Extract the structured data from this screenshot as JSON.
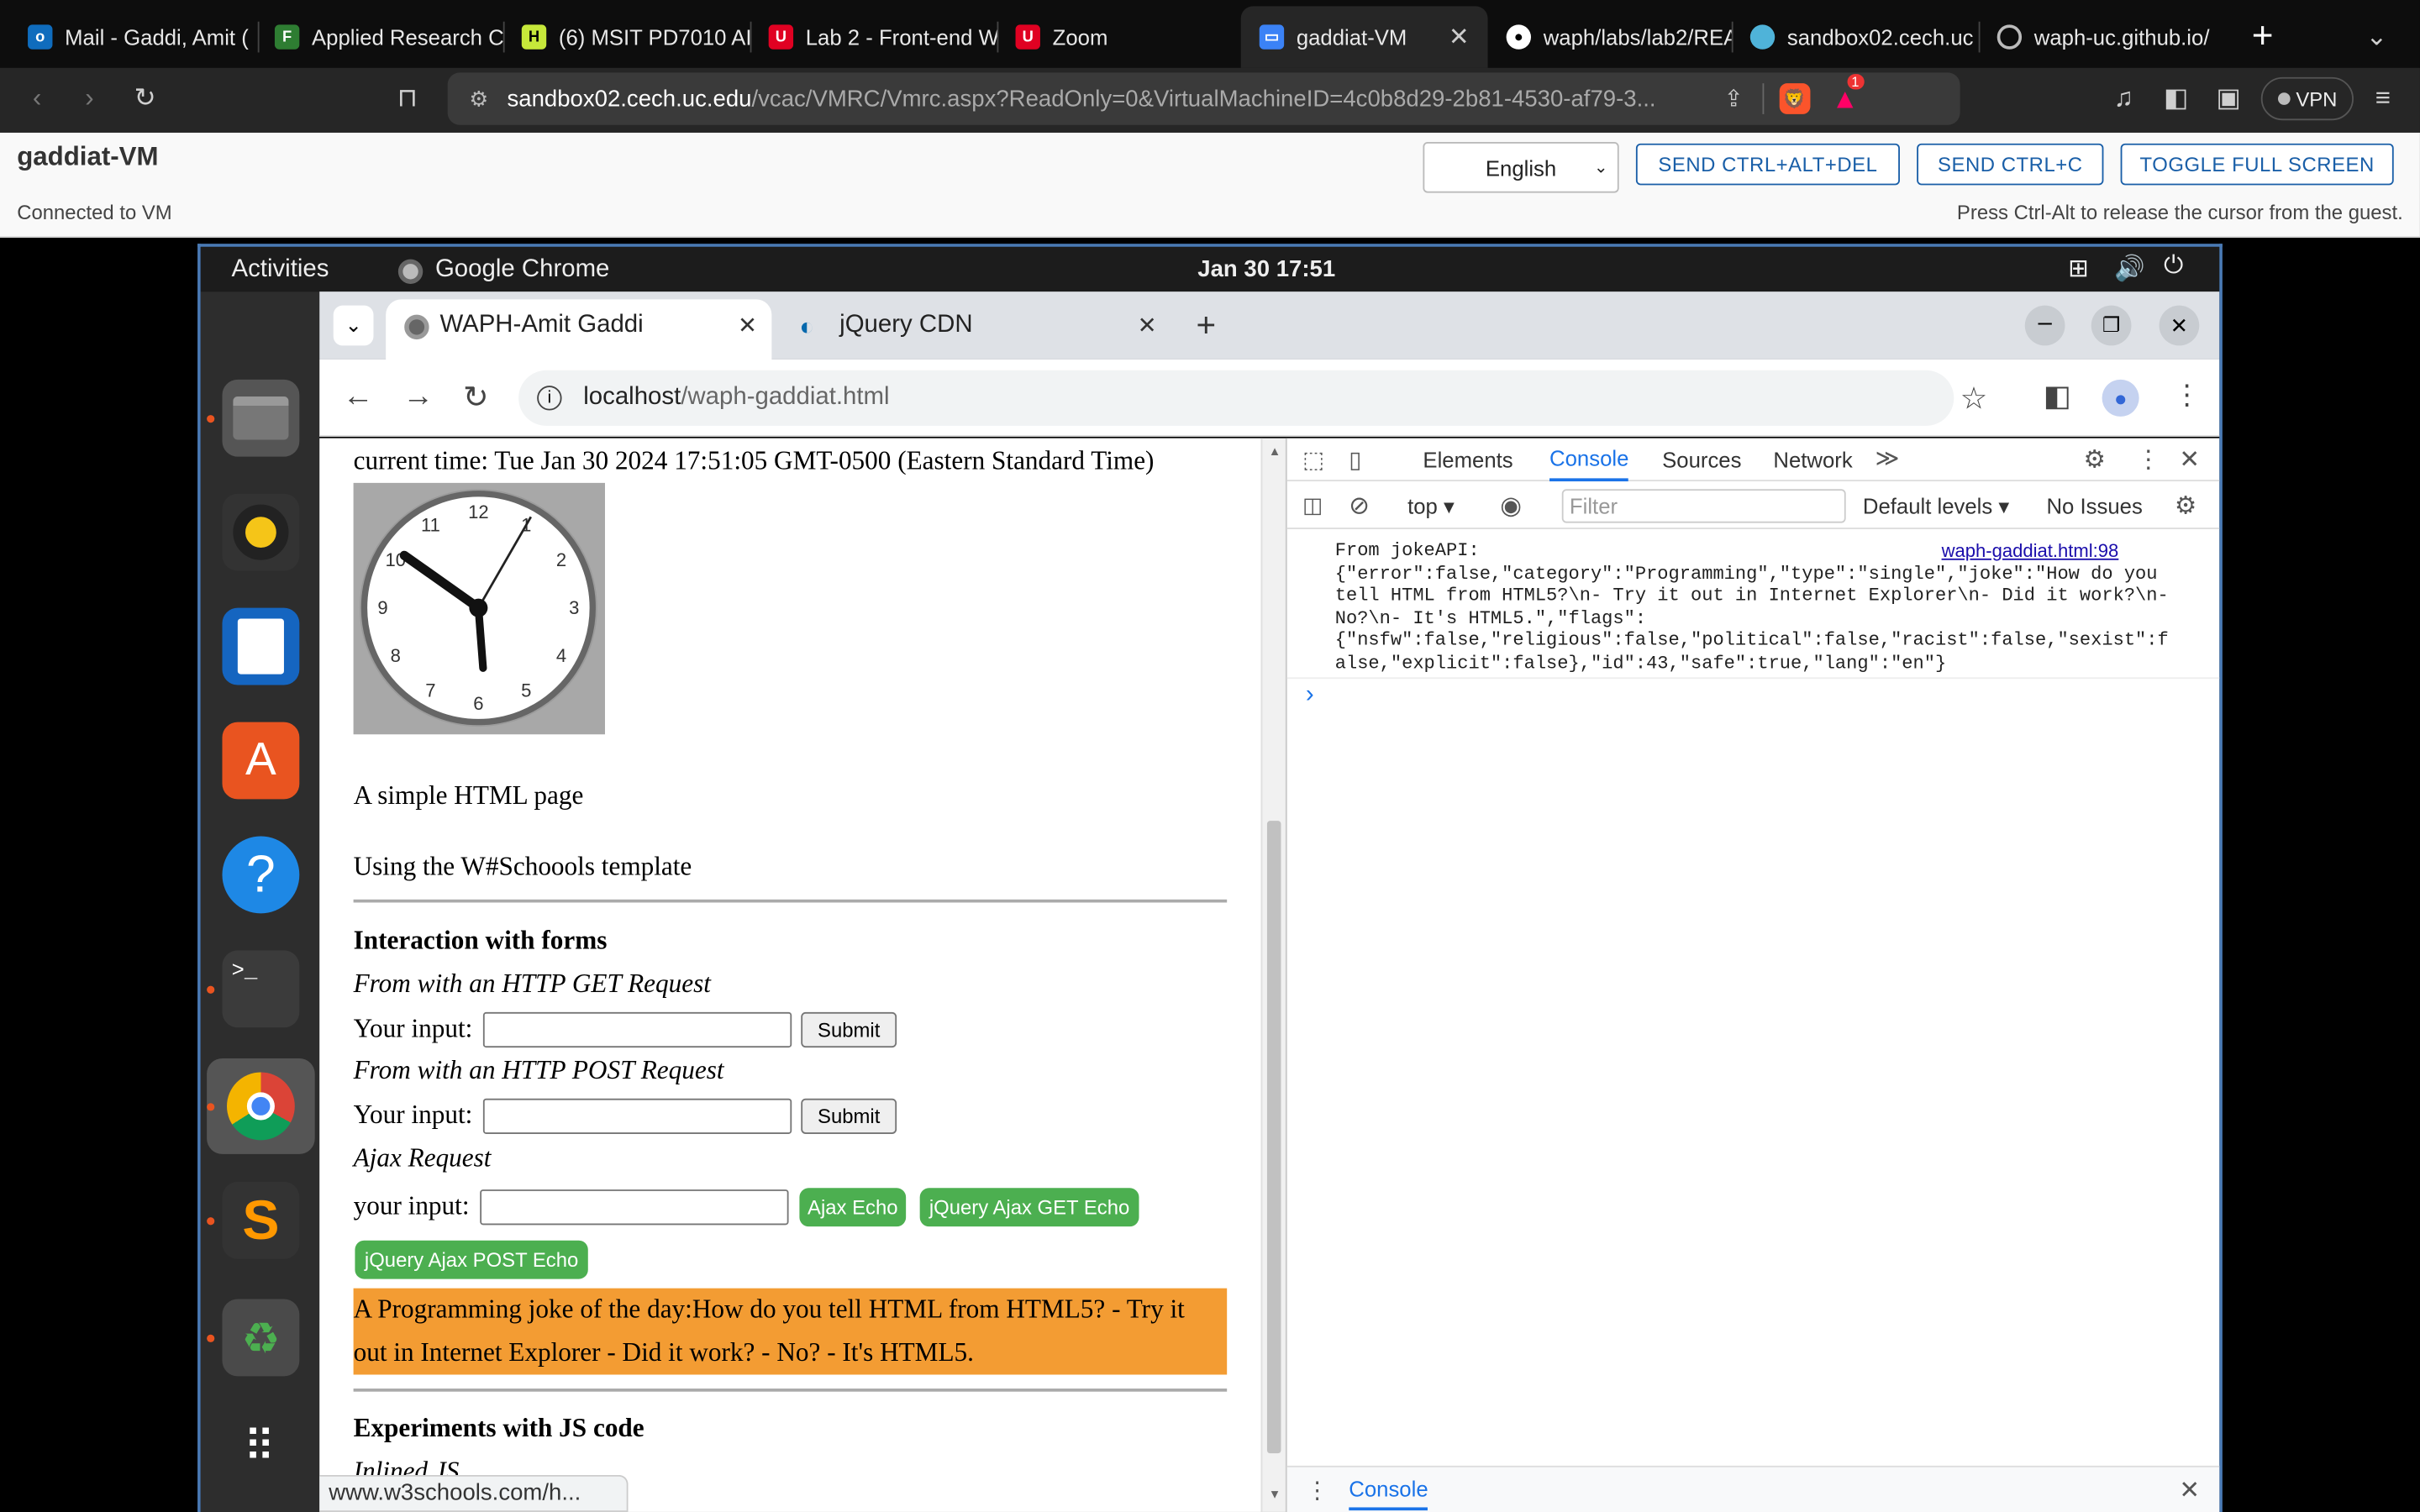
{
  "host": {
    "tabs": [
      {
        "label": "Mail - Gaddi, Amit (",
        "icon": "outlook-icon",
        "color": "#0f6cbd"
      },
      {
        "label": "Applied Research C",
        "icon": "forms-icon",
        "color": "#2e7d32"
      },
      {
        "label": "(6) MSIT PD7010 AI",
        "icon": "h-icon",
        "color": "#c6e83a"
      },
      {
        "label": "Lab 2 - Front-end W",
        "icon": "uc-icon",
        "color": "#e00122"
      },
      {
        "label": "Zoom",
        "icon": "uc-icon",
        "color": "#e00122"
      },
      {
        "label": "gaddiat-VM",
        "icon": "monitor-icon",
        "color": "#3b82f6"
      },
      {
        "label": "waph/labs/lab2/REA",
        "icon": "github-icon",
        "color": "#fff"
      },
      {
        "label": "sandbox02.cech.uc",
        "icon": "globe-icon",
        "color": "#4fb3d9"
      },
      {
        "label": "waph-uc.github.io/",
        "icon": "globe-icon",
        "color": "#bbb"
      }
    ],
    "url_domain": "sandbox02.cech.uc.edu",
    "url_path": "/vcac/VMRC/Vmrc.aspx?ReadOnly=0&VirtualMachineID=4c0b8d29-2b81-4530-af79-3...",
    "vpn": "VPN",
    "brave_badge": "1"
  },
  "vmrc": {
    "title": "gaddiat-VM",
    "status": "Connected to VM",
    "language": "English",
    "btn_cad": "SEND CTRL+ALT+DEL",
    "btn_cc": "SEND CTRL+C",
    "btn_fs": "TOGGLE FULL SCREEN",
    "hint": "Press Ctrl-Alt to release the cursor from the guest."
  },
  "gnome": {
    "activities": "Activities",
    "app": "Google Chrome",
    "clock": "Jan 30  17:51"
  },
  "guest_chrome": {
    "tab1": "WAPH-Amit Gaddi",
    "tab2": "jQuery CDN",
    "url_host": "localhost",
    "url_path": "/waph-gaddiat.html",
    "status_url": "www.w3schools.com/h..."
  },
  "page": {
    "current_time": "current time: Tue Jan 30 2024 17:51:05 GMT-0500 (Eastern Standard Time)",
    "clock_numbers": [
      "12",
      "1",
      "2",
      "3",
      "4",
      "5",
      "6",
      "7",
      "8",
      "9",
      "10",
      "11"
    ],
    "simple": "A simple HTML page",
    "template": "Using the W#Schoools template",
    "forms_heading": "Interaction with forms",
    "get_label": "From with an HTTP GET Request",
    "your_input": "Your input:",
    "submit": "Submit",
    "post_label": "From with an HTTP POST Request",
    "ajax_label": "Ajax Request",
    "your_input_lc": "your input:",
    "ajax_echo": "Ajax Echo",
    "jq_get": "jQuery Ajax GET Echo",
    "jq_post": "jQuery Ajax POST Echo",
    "joke_line1": "A Programming joke of the day:How do you tell HTML from HTML5? - Try it",
    "joke_line2": "out in Internet Explorer - Did it work? - No? - It's HTML5.",
    "js_heading": "Experiments with JS code",
    "inlined": "Inlined JS"
  },
  "devtools": {
    "tabs": [
      "Elements",
      "Console",
      "Sources",
      "Network"
    ],
    "context": "top",
    "filter_placeholder": "Filter",
    "levels": "Default levels",
    "issues": "No Issues",
    "source_link": "waph-gaddiat.html:98",
    "log_lines": [
      "From jokeAPI:",
      "{\"error\":false,\"category\":\"Programming\",\"type\":\"single\",\"joke\":\"How do you",
      "tell HTML from HTML5?\\n- Try it out in Internet Explorer\\n- Did it work?\\n-",
      "No?\\n- It's HTML5.\",\"flags\":",
      "{\"nsfw\":false,\"religious\":false,\"political\":false,\"racist\":false,\"sexist\":f",
      "alse,\"explicit\":false},\"id\":43,\"safe\":true,\"lang\":\"en\"}"
    ],
    "drawer_tab": "Console"
  }
}
